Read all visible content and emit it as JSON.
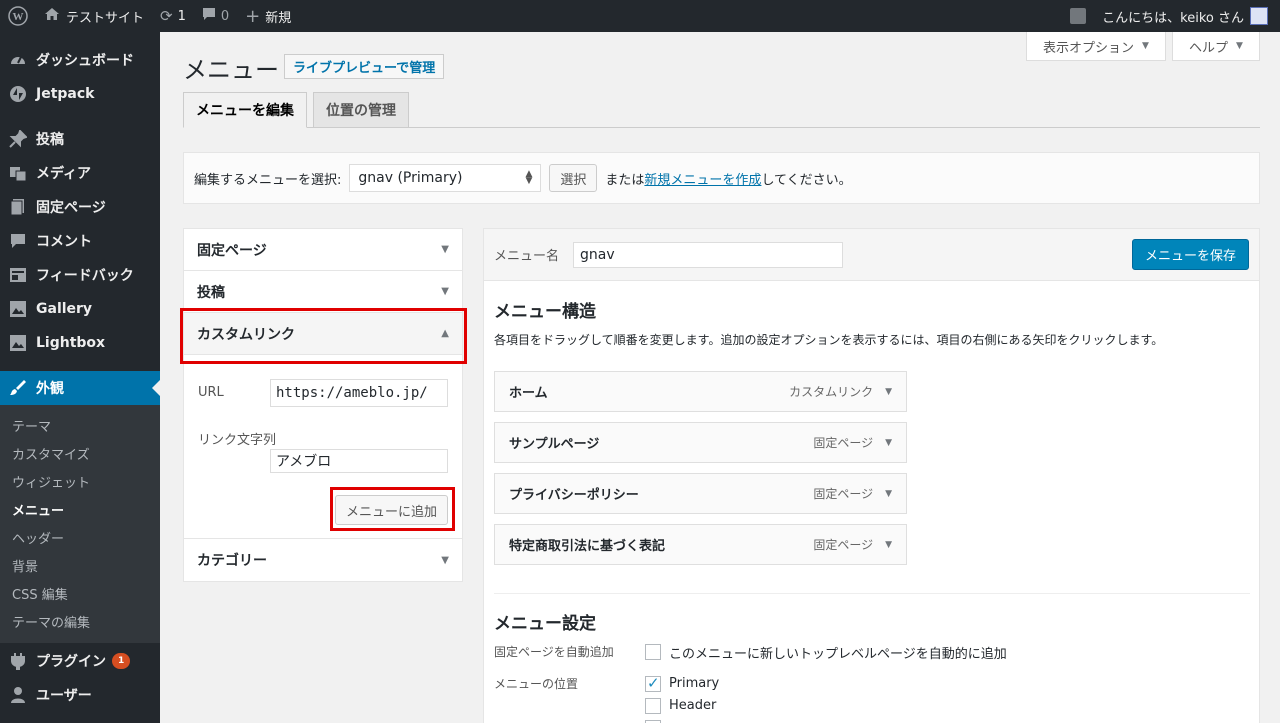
{
  "adminbar": {
    "site": "テストサイト",
    "updates_count": "1",
    "comments_count": "0",
    "new_label": "新規",
    "greeting": "こんにちは、keiko さん"
  },
  "sidebar": {
    "items": [
      {
        "label": "ダッシュボード",
        "icon": "dashboard-icon"
      },
      {
        "label": "Jetpack",
        "icon": "jetpack-icon"
      },
      {
        "label": "投稿",
        "icon": "pin-icon"
      },
      {
        "label": "メディア",
        "icon": "media-icon"
      },
      {
        "label": "固定ページ",
        "icon": "page-icon"
      },
      {
        "label": "コメント",
        "icon": "comment-icon"
      },
      {
        "label": "フィードバック",
        "icon": "feedback-icon"
      },
      {
        "label": "Gallery",
        "icon": "gallery-icon"
      },
      {
        "label": "Lightbox",
        "icon": "lightbox-icon"
      },
      {
        "label": "外観",
        "icon": "brush-icon"
      },
      {
        "label": "プラグイン",
        "icon": "plugin-icon",
        "badge": "1"
      },
      {
        "label": "ユーザー",
        "icon": "user-icon"
      }
    ],
    "submenu": [
      "テーマ",
      "カスタマイズ",
      "ウィジェット",
      "メニュー",
      "ヘッダー",
      "背景",
      "CSS 編集",
      "テーマの編集"
    ]
  },
  "screen_options": "表示オプション",
  "help": "ヘルプ",
  "page": {
    "title": "メニュー",
    "title_action": "ライブプレビューで管理",
    "tabs": [
      "メニューを編集",
      "位置の管理"
    ]
  },
  "manage": {
    "label": "編集するメニューを選択:",
    "selected": "gnav (Primary)",
    "select_button": "選択",
    "or_text": "または",
    "new_link": "新規メニューを作成",
    "suffix": "してください。"
  },
  "accordion": {
    "sections": [
      "固定ページ",
      "投稿",
      "カスタムリンク",
      "カテゴリー"
    ],
    "url_label": "URL",
    "url_value": "https://ameblo.jp/",
    "link_text_label": "リンク文字列",
    "link_text_value": "アメブロ",
    "add_button": "メニューに追加"
  },
  "menu": {
    "name_label": "メニュー名",
    "name_value": "gnav",
    "save_button": "メニューを保存",
    "structure_title": "メニュー構造",
    "structure_desc": "各項目をドラッグして順番を変更します。追加の設定オプションを表示するには、項目の右側にある矢印をクリックします。",
    "items": [
      {
        "title": "ホーム",
        "type": "カスタムリンク"
      },
      {
        "title": "サンプルページ",
        "type": "固定ページ"
      },
      {
        "title": "プライバシーポリシー",
        "type": "固定ページ"
      },
      {
        "title": "特定商取引法に基づく表記",
        "type": "固定ページ"
      }
    ],
    "settings_title": "メニュー設定",
    "auto_add_label": "固定ページを自動追加",
    "auto_add_text": "このメニューに新しいトップレベルページを自動的に追加",
    "location_label": "メニューの位置",
    "locations": [
      "Primary",
      "Header"
    ]
  }
}
